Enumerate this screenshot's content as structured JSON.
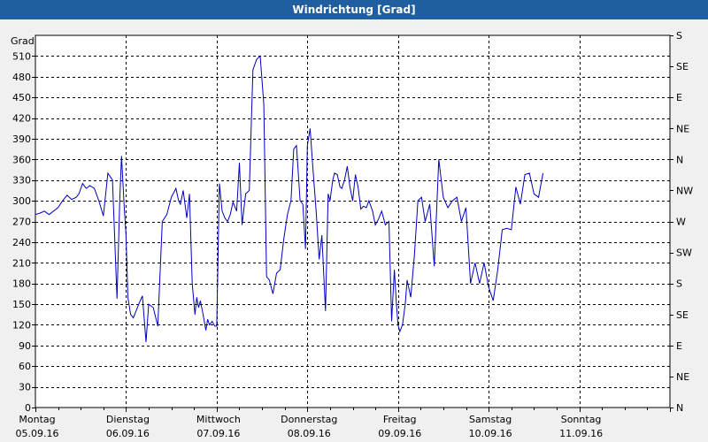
{
  "chart_data": {
    "type": "line",
    "title": "Windrichtung [Grad]",
    "ylabel": "Grad",
    "ylim": [
      0,
      540
    ],
    "y_ticks": [
      0,
      30,
      60,
      90,
      120,
      150,
      180,
      210,
      240,
      270,
      300,
      330,
      360,
      390,
      420,
      450,
      480,
      510
    ],
    "right_axis_labels": [
      "N",
      "NE",
      "E",
      "SE",
      "S",
      "SW",
      "W",
      "NW",
      "N",
      "NE",
      "E",
      "SE",
      "S"
    ],
    "right_axis_values": [
      0,
      45,
      90,
      135,
      180,
      225,
      270,
      315,
      360,
      405,
      450,
      495,
      540
    ],
    "x_range": [
      "05.09.16 00:00",
      "12.09.16 00:00"
    ],
    "x_day_labels": [
      {
        "day": "Montag",
        "date": "05.09.16"
      },
      {
        "day": "Dienstag",
        "date": "06.09.16"
      },
      {
        "day": "Mittwoch",
        "date": "07.09.16"
      },
      {
        "day": "Donnerstag",
        "date": "08.09.16"
      },
      {
        "day": "Freitag",
        "date": "09.09.16"
      },
      {
        "day": "Samstag",
        "date": "10.09.16"
      },
      {
        "day": "Sonntag",
        "date": "11.09.16"
      }
    ],
    "grid": true,
    "line_color": "#0000c0",
    "series": [
      {
        "x_days": [
          0.0,
          0.05,
          0.1,
          0.15,
          0.2,
          0.25,
          0.3,
          0.35,
          0.4,
          0.45,
          0.48,
          0.52,
          0.56,
          0.6,
          0.65,
          0.7,
          0.75,
          0.8,
          0.85,
          0.9,
          0.93,
          0.95,
          0.98,
          1.0,
          1.02,
          1.05,
          1.08,
          1.11,
          1.14,
          1.18,
          1.22,
          1.25,
          1.3,
          1.35,
          1.4,
          1.45,
          1.5,
          1.55,
          1.58,
          1.6,
          1.63,
          1.67,
          1.7,
          1.73,
          1.76,
          1.78,
          1.8,
          1.82,
          1.85,
          1.88,
          1.9,
          1.92,
          1.95,
          1.98,
          2.0,
          2.03,
          2.06,
          2.09,
          2.12,
          2.15,
          2.18,
          2.22,
          2.25,
          2.28,
          2.32,
          2.36,
          2.4,
          2.44,
          2.48,
          2.52,
          2.55,
          2.58,
          2.62,
          2.66,
          2.7,
          2.74,
          2.78,
          2.82,
          2.85,
          2.88,
          2.92,
          2.95,
          2.98,
          3.0,
          3.03,
          3.06,
          3.1,
          3.13,
          3.16,
          3.2,
          3.23,
          3.25,
          3.28,
          3.3,
          3.33,
          3.36,
          3.38,
          3.41,
          3.44,
          3.47,
          3.5,
          3.53,
          3.56,
          3.59,
          3.62,
          3.65,
          3.68,
          3.72,
          3.75,
          3.78,
          3.82,
          3.86,
          3.9,
          3.93,
          3.96,
          3.98,
          4.0,
          4.02,
          4.05,
          4.08,
          4.1,
          4.14,
          4.18,
          4.22,
          4.26,
          4.3,
          4.35,
          4.4,
          4.45,
          4.5,
          4.55,
          4.6,
          4.65,
          4.7,
          4.75,
          4.8,
          4.85,
          4.9,
          4.95,
          5.0,
          5.05,
          5.1,
          5.15,
          5.2,
          5.25,
          5.3,
          5.35,
          5.4,
          5.45,
          5.5,
          5.55,
          5.6,
          5.65,
          5.7,
          5.75,
          5.8,
          5.85,
          5.9,
          5.95,
          6.0,
          6.02,
          6.05,
          6.08,
          6.11,
          6.14,
          6.18,
          6.22,
          6.26,
          6.3,
          6.34,
          6.38,
          6.42,
          6.46,
          6.5,
          6.54,
          6.58,
          6.62,
          6.66,
          6.7,
          6.75,
          6.8,
          6.85,
          6.9,
          6.95,
          7.0
        ],
        "values": [
          280,
          282,
          285,
          280,
          285,
          290,
          300,
          308,
          302,
          305,
          310,
          325,
          318,
          322,
          318,
          300,
          278,
          340,
          330,
          158,
          300,
          365,
          290,
          250,
          160,
          135,
          130,
          140,
          150,
          162,
          95,
          150,
          145,
          118,
          270,
          280,
          305,
          318,
          300,
          295,
          315,
          275,
          310,
          180,
          135,
          160,
          145,
          155,
          135,
          112,
          128,
          120,
          125,
          118,
          118,
          325,
          285,
          275,
          270,
          280,
          298,
          285,
          355,
          265,
          310,
          315,
          490,
          505,
          510,
          440,
          190,
          185,
          165,
          195,
          200,
          245,
          280,
          300,
          375,
          380,
          300,
          295,
          230,
          380,
          405,
          350,
          280,
          215,
          250,
          140,
          310,
          300,
          330,
          340,
          338,
          320,
          318,
          330,
          350,
          320,
          300,
          338,
          320,
          288,
          292,
          290,
          300,
          285,
          265,
          272,
          285,
          265,
          270,
          125,
          200,
          155,
          120,
          110,
          120,
          150,
          185,
          160,
          220,
          300,
          305,
          270,
          295,
          205,
          360,
          305,
          290,
          300,
          305,
          270,
          290,
          180,
          210,
          180,
          210,
          175,
          155,
          200,
          258,
          260,
          258,
          320,
          295,
          338,
          340,
          310,
          305,
          340
        ],
        "note": "Grad"
      }
    ]
  }
}
